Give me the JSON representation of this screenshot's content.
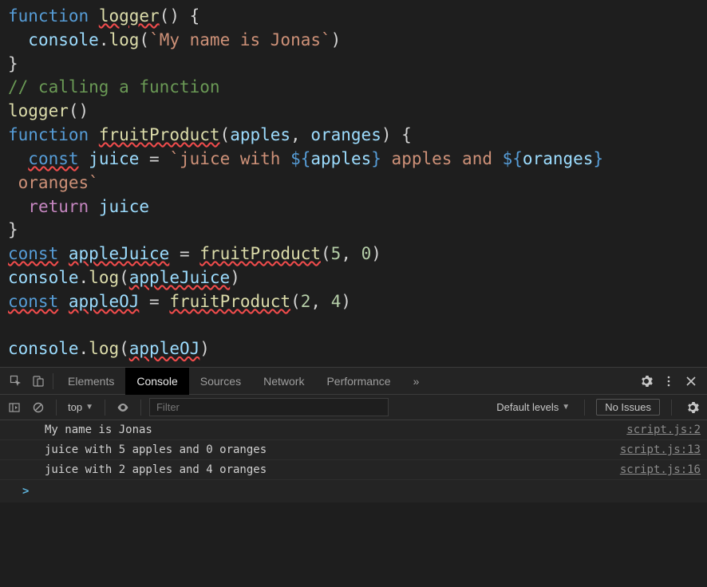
{
  "code": {
    "tokens": {
      "function": "function",
      "logger": "logger",
      "console": "console",
      "log": "log",
      "str_myname": "My name is Jonas",
      "comment_call": "// calling a function",
      "fruitProduct": "fruitProduct",
      "apples": "apples",
      "oranges": "oranges",
      "const": "const",
      "juice": "juice",
      "str_juicewith": "juice with ",
      "str_applesand": " apples and ",
      "str_orangesnl": "\n oranges",
      "return": "return",
      "appleJuice": "appleJuice",
      "appleOJ": "appleOJ",
      "n5": "5",
      "n0": "0",
      "n2": "2",
      "n4": "4"
    }
  },
  "devtools": {
    "tabs": {
      "elements": "Elements",
      "console": "Console",
      "sources": "Sources",
      "network": "Network",
      "performance": "Performance",
      "more": "»"
    },
    "toolbar": {
      "context": "top",
      "filter_placeholder": "Filter",
      "levels": "Default levels",
      "noissues": "No Issues"
    },
    "output": [
      {
        "msg": "My name is Jonas",
        "src": "script.js:2"
      },
      {
        "msg": "juice with 5 apples and 0 oranges",
        "src": "script.js:13"
      },
      {
        "msg": "juice with 2 apples and 4 oranges",
        "src": "script.js:16"
      }
    ],
    "prompt": ">"
  }
}
